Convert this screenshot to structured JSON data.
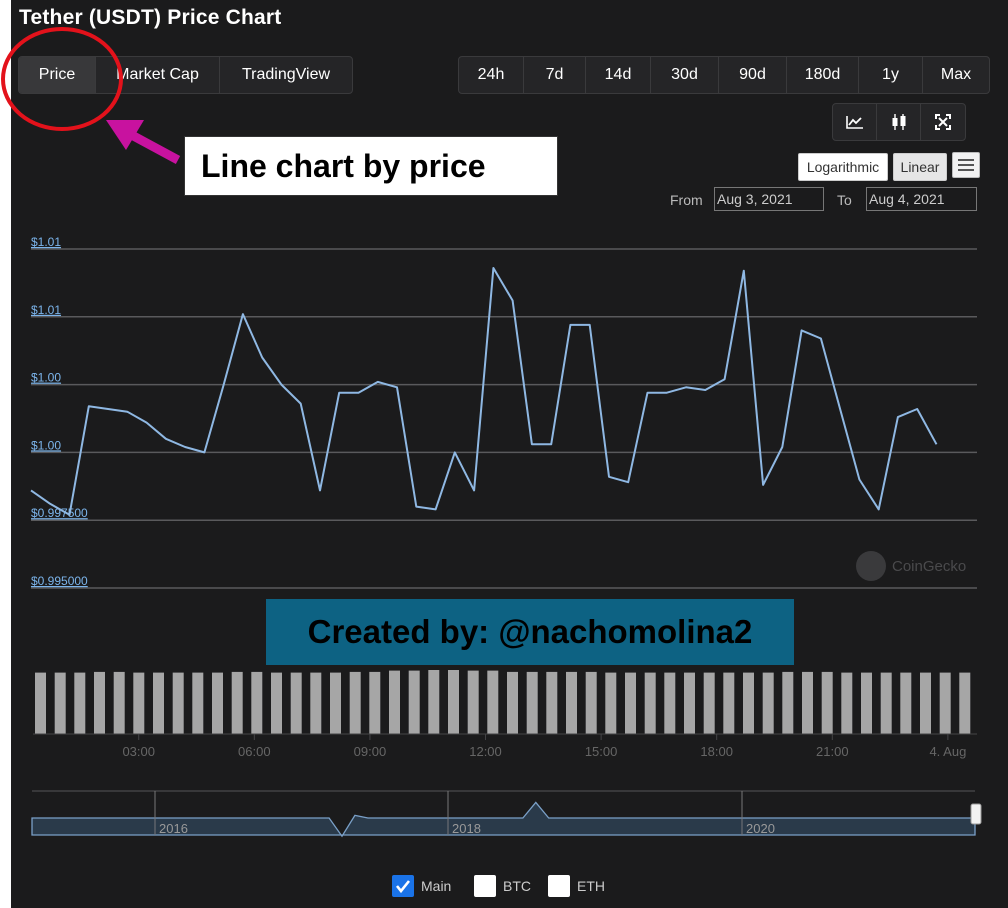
{
  "page": {
    "title": "Tether (USDT) Price Chart"
  },
  "chart_tabs": [
    {
      "label": "Price",
      "active": true
    },
    {
      "label": "Market Cap",
      "active": false
    },
    {
      "label": "TradingView",
      "active": false
    }
  ],
  "time_ranges": [
    "24h",
    "7d",
    "14d",
    "30d",
    "90d",
    "180d",
    "1y",
    "Max"
  ],
  "chart_style_icons": [
    "line-chart-icon",
    "candlestick-icon",
    "fullscreen-icon"
  ],
  "scale": {
    "logarithmic_label": "Logarithmic",
    "linear_label": "Linear",
    "selected": "Linear"
  },
  "date_range": {
    "from_label": "From",
    "from_value": "Aug 3, 2021",
    "to_label": "To",
    "to_value": "Aug 4, 2021"
  },
  "watermark": "CoinGecko",
  "legend": [
    {
      "label": "Main",
      "checked": true
    },
    {
      "label": "BTC",
      "checked": false
    },
    {
      "label": "ETH",
      "checked": false
    }
  ],
  "annotations": {
    "callout_text": "Line chart by price",
    "credit_text": "Created by: @nachomolina2",
    "colors": {
      "circle": "#e3121b",
      "arrow": "#c8129f"
    }
  },
  "colors": {
    "background": "#1b1b1c",
    "price_line": "#8fb8e3",
    "axis_label": "#7cb5ec",
    "volume_bar": "#a6a6a6",
    "gridline": "#5a5a5c"
  },
  "chart_data": [
    {
      "type": "line",
      "title": "",
      "ylabel": "",
      "y_ticks": [
        "$1.01",
        "$1.01",
        "$1.00",
        "$1.00",
        "$0.997500",
        "$0.995000"
      ],
      "y_tick_values": [
        1.0075,
        1.005,
        1.0025,
        1.0,
        0.9975,
        0.995
      ],
      "ylim": [
        0.995,
        1.0075
      ],
      "x_ticks": [
        "03:00",
        "06:00",
        "09:00",
        "12:00",
        "15:00",
        "18:00",
        "21:00",
        "4. Aug"
      ],
      "x_tick_hours": [
        3,
        6,
        9,
        12,
        15,
        18,
        21,
        24
      ],
      "xlim_hours": [
        0.1,
        24.6
      ],
      "series": [
        {
          "x_hours": [
            0.1,
            0.6,
            1.1,
            1.6,
            2.1,
            2.6,
            3.1,
            3.6,
            4.1,
            4.6,
            5.1,
            5.6,
            6.1,
            6.6,
            7.1,
            7.6,
            8.1,
            8.6,
            9.1,
            9.6,
            10.1,
            10.6,
            11.1,
            11.6,
            12.1,
            12.6,
            13.1,
            13.6,
            14.1,
            14.6,
            15.1,
            15.6,
            16.1,
            16.6,
            17.1,
            17.6,
            18.1,
            18.6,
            19.1,
            19.6,
            20.1,
            20.6,
            21.1,
            21.6,
            22.1,
            22.6,
            23.1,
            23.6,
            24.1,
            24.6
          ],
          "values": [
            0.9986,
            0.9981,
            0.9977,
            1.0017,
            1.0016,
            1.0015,
            1.0011,
            1.0005,
            1.0002,
            1.0,
            1.0025,
            1.0051,
            1.0035,
            1.0025,
            1.0018,
            0.9986,
            1.0022,
            1.0022,
            1.0026,
            1.0024,
            0.998,
            0.9979,
            1.0,
            0.9986,
            1.0068,
            1.0056,
            1.0003,
            1.0003,
            1.0047,
            1.0047,
            0.9991,
            0.9989,
            1.0022,
            1.0022,
            1.0024,
            1.0023,
            1.0027,
            1.0067,
            0.9988,
            1.0002,
            1.0045,
            1.0042,
            1.0016,
            0.999,
            0.9979,
            1.0013,
            1.0016,
            1.0003
          ]
        }
      ]
    },
    {
      "type": "bar",
      "title": "",
      "series": [
        {
          "values": [
            0.96,
            0.96,
            0.96,
            0.97,
            0.97,
            0.96,
            0.96,
            0.96,
            0.96,
            0.96,
            0.97,
            0.97,
            0.96,
            0.96,
            0.96,
            0.96,
            0.97,
            0.97,
            0.99,
            0.99,
            1.0,
            1.0,
            0.99,
            0.99,
            0.97,
            0.97,
            0.97,
            0.97,
            0.97,
            0.96,
            0.96,
            0.96,
            0.96,
            0.96,
            0.96,
            0.96,
            0.96,
            0.96,
            0.97,
            0.97,
            0.97,
            0.96,
            0.96,
            0.96,
            0.96,
            0.96,
            0.96,
            0.96
          ]
        }
      ]
    },
    {
      "type": "area",
      "title": "",
      "x_ticks": [
        "2016",
        "2018",
        "2020"
      ],
      "series": [
        {
          "values": [
            1.0,
            1.0,
            1.0,
            1.0,
            1.0,
            1.0,
            1.0,
            1.0,
            1.0,
            1.0,
            1.0,
            1.0,
            1.0,
            1.0,
            1.0,
            1.0,
            1.0,
            1.0,
            1.0,
            1.0,
            1.0,
            1.0,
            1.0,
            1.0,
            0.93,
            1.01,
            1.0,
            1.0,
            1.0,
            1.0,
            1.0,
            1.0,
            1.0,
            1.0,
            1.0,
            1.0,
            1.0,
            1.0,
            1.0,
            1.06,
            1.0,
            1.0,
            1.0,
            1.0,
            1.0,
            1.0,
            1.0,
            1.0,
            1.0,
            1.0,
            1.0,
            1.0,
            1.0,
            1.0,
            1.0,
            1.0,
            1.0,
            1.0,
            1.0,
            1.0,
            1.0,
            1.0,
            1.0,
            1.0,
            1.0,
            1.0,
            1.0,
            1.0,
            1.0,
            1.0,
            1.0,
            1.0,
            1.0,
            1.0
          ]
        }
      ]
    }
  ]
}
